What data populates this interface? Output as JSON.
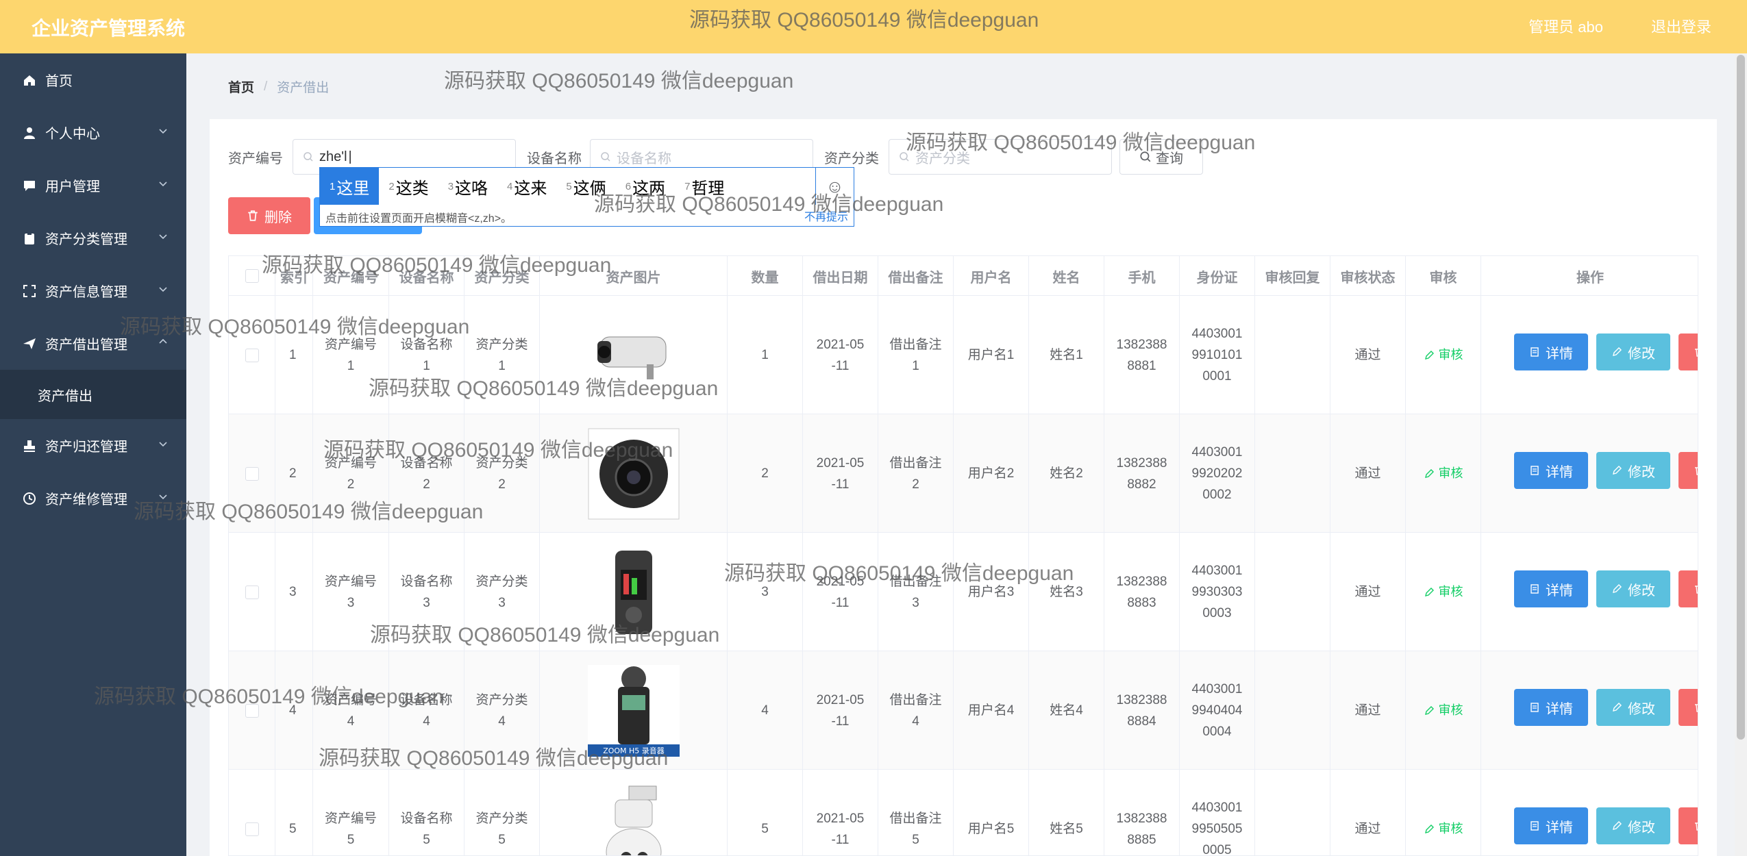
{
  "header": {
    "brand": "企业资产管理系统",
    "user": "管理员 abo",
    "logout": "退出登录"
  },
  "sidebar": {
    "items": [
      {
        "label": "首页",
        "icon": "home-icon",
        "has_arrow": false
      },
      {
        "label": "个人中心",
        "icon": "user-icon",
        "has_arrow": true
      },
      {
        "label": "用户管理",
        "icon": "chat-icon",
        "has_arrow": true
      },
      {
        "label": "资产分类管理",
        "icon": "clipboard-icon",
        "has_arrow": true
      },
      {
        "label": "资产信息管理",
        "icon": "fullscreen-icon",
        "has_arrow": true
      },
      {
        "label": "资产借出管理",
        "icon": "send-icon",
        "has_arrow": true,
        "expanded": true,
        "children": [
          {
            "label": "资产借出"
          }
        ]
      },
      {
        "label": "资产归还管理",
        "icon": "stamp-icon",
        "has_arrow": true
      },
      {
        "label": "资产维修管理",
        "icon": "clock-icon",
        "has_arrow": true
      }
    ]
  },
  "breadcrumb": {
    "home": "首页",
    "separator": "/",
    "current": "资产借出"
  },
  "search": {
    "asset_no_label": "资产编号",
    "asset_no_value": "zhe'l",
    "device_name_label": "设备名称",
    "device_name_placeholder": "设备名称",
    "category_label": "资产分类",
    "category_placeholder": "资产分类",
    "query_button": "查询"
  },
  "toolbar": {
    "delete_button": "删除"
  },
  "ime": {
    "candidates": [
      {
        "num": "1",
        "text": "这里"
      },
      {
        "num": "2",
        "text": "这类"
      },
      {
        "num": "3",
        "text": "这咯"
      },
      {
        "num": "4",
        "text": "这来"
      },
      {
        "num": "5",
        "text": "这俩"
      },
      {
        "num": "6",
        "text": "这两"
      },
      {
        "num": "7",
        "text": "哲理"
      }
    ],
    "tip": "点击前往设置页面开启模糊音<z,zh>。",
    "dismiss": "不再提示",
    "emoji": "☺"
  },
  "table": {
    "columns": [
      "索引",
      "资产编号",
      "设备名称",
      "资产分类",
      "资产图片",
      "数量",
      "借出日期",
      "借出备注",
      "用户名",
      "姓名",
      "手机",
      "身份证",
      "审核回复",
      "审核状态",
      "审核",
      "操作"
    ],
    "rows": [
      {
        "index": "1",
        "asset_no": "资产编号\n1",
        "device": "设备名称\n1",
        "category": "资产分类\n1",
        "image": "bullet-camera",
        "qty": "1",
        "date": "2021-05\n-11",
        "remark": "借出备注\n1",
        "username": "用户名1",
        "name": "姓名1",
        "phone": "1382388\n8881",
        "id": "4403001\n9910101\n0001",
        "reply": "",
        "status": "通过",
        "audit": "审核"
      },
      {
        "index": "2",
        "asset_no": "资产编号\n2",
        "device": "设备名称\n2",
        "category": "资产分类\n2",
        "image": "dome-camera",
        "qty": "2",
        "date": "2021-05\n-11",
        "remark": "借出备注\n2",
        "username": "用户名2",
        "name": "姓名2",
        "phone": "1382388\n8882",
        "id": "4403001\n9920202\n0002",
        "reply": "",
        "status": "通过",
        "audit": "审核"
      },
      {
        "index": "3",
        "asset_no": "资产编号\n3",
        "device": "设备名称\n3",
        "category": "资产分类\n3",
        "image": "recorder",
        "qty": "3",
        "date": "2021-05\n-11",
        "remark": "借出备注\n3",
        "username": "用户名3",
        "name": "姓名3",
        "phone": "1382388\n8883",
        "id": "4403001\n9930303\n0003",
        "reply": "",
        "status": "通过",
        "audit": "审核"
      },
      {
        "index": "4",
        "asset_no": "资产编号\n4",
        "device": "设备名称\n4",
        "category": "资产分类\n4",
        "image": "zoom-recorder",
        "qty": "4",
        "date": "2021-05\n-11",
        "remark": "借出备注\n4",
        "username": "用户名4",
        "name": "姓名4",
        "phone": "1382388\n8884",
        "id": "4403001\n9940404\n0004",
        "reply": "",
        "status": "通过",
        "audit": "审核"
      },
      {
        "index": "5",
        "asset_no": "资产编号\n5",
        "device": "设备名称\n5",
        "category": "资产分类\n5",
        "image": "ptz-camera",
        "qty": "5",
        "date": "2021-05\n-11",
        "remark": "借出备注\n5",
        "username": "用户名5",
        "name": "姓名5",
        "phone": "1382388\n8885",
        "id": "4403001\n9950505\n0005",
        "reply": "",
        "status": "通过",
        "audit": "审核"
      }
    ],
    "detail_button": "详情",
    "edit_button": "修改",
    "zoom_caption": "ZOOM H5 录音器"
  },
  "watermark": "源码获取 QQ86050149 微信deepguan",
  "colors": {
    "header": "#fdd66e",
    "sidebar": "#304156",
    "danger": "#f56c6c",
    "primary": "#409eff",
    "success": "#13ce66"
  }
}
